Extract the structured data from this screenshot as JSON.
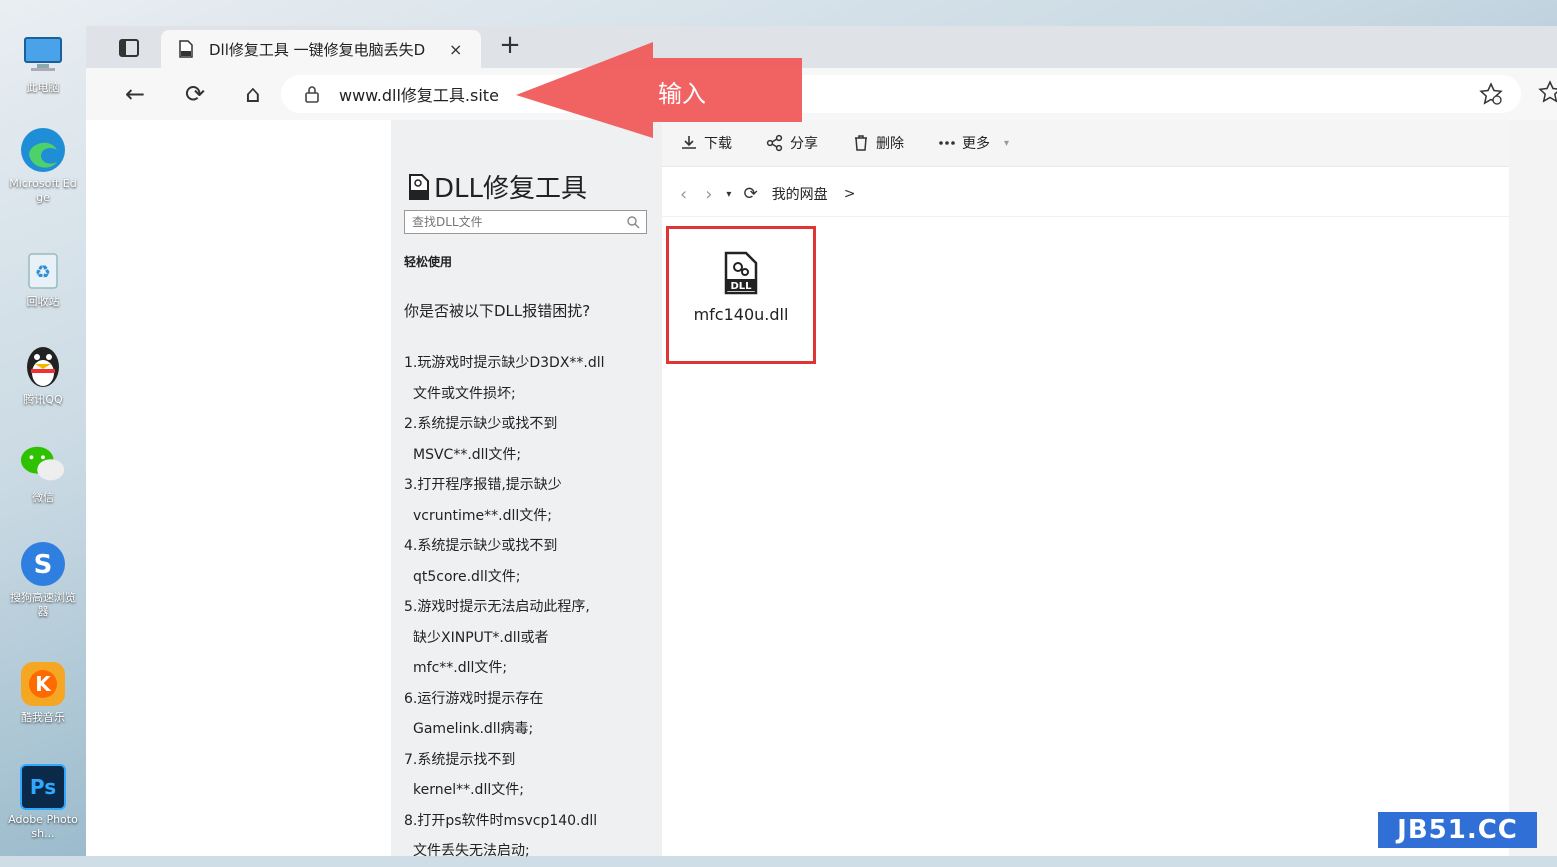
{
  "desktop": {
    "icons": [
      {
        "label": "此电脑",
        "icon": "computer-icon",
        "color": "#3a8dde"
      },
      {
        "label": "Microsoft Edge",
        "icon": "edge-icon",
        "color": "#1f8ed6"
      },
      {
        "label": "回收站",
        "icon": "recycle-bin-icon",
        "color": "#5aa9d6"
      },
      {
        "label": "腾讯QQ",
        "icon": "qq-icon",
        "color": "#222222"
      },
      {
        "label": "微信",
        "icon": "wechat-icon",
        "color": "#2dc100"
      },
      {
        "label": "搜狗高速浏览器",
        "icon": "sogou-browser-icon",
        "color": "#2f7fe0"
      },
      {
        "label": "酷我音乐",
        "icon": "kuwo-music-icon",
        "color": "#f5a623"
      },
      {
        "label": "Adobe Photosh...",
        "icon": "photoshop-icon",
        "color": "#0b2a4a"
      }
    ]
  },
  "browser": {
    "tab": {
      "title": "Dll修复工具 一键修复电脑丢失D",
      "close": "×"
    },
    "new_tab": "+",
    "nav": {
      "back": "←",
      "reload": "⟳",
      "home": "⌂"
    },
    "address": {
      "url": "www.dll修复工具.site"
    }
  },
  "annotation": {
    "label": "输入",
    "color": "#f05a5a"
  },
  "page": {
    "site_title": "DLL修复工具",
    "search": {
      "placeholder": "查找DLL文件"
    },
    "easy_use": "轻松使用",
    "question": "你是否被以下DLL报错困扰?",
    "issues": [
      {
        "line1": "1.玩游戏时提示缺少D3DX**.dll",
        "line2": "文件或文件损坏;"
      },
      {
        "line1": "2.系统提示缺少或找不到",
        "line2": "MSVC**.dll文件;"
      },
      {
        "line1": "3.打开程序报错,提示缺少",
        "line2": "vcruntime**.dll文件;"
      },
      {
        "line1": "4.系统提示缺少或找不到",
        "line2": "qt5core.dll文件;"
      },
      {
        "line1": "5.游戏时提示无法启动此程序,",
        "line2": "缺少XINPUT*.dll或者",
        "line3": "mfc**.dll文件;"
      },
      {
        "line1": "6.运行游戏时提示存在",
        "line2": "Gamelink.dll病毒;"
      },
      {
        "line1": "7.系统提示找不到",
        "line2": "kernel**.dll文件;"
      },
      {
        "line1": "8.打开ps软件时msvcp140.dll",
        "line2": "文件丢失无法启动;"
      }
    ],
    "file_toolbar": {
      "download": "下载",
      "share": "分享",
      "delete": "删除",
      "more": "更多"
    },
    "breadcrumb": {
      "home": "我的网盘",
      "sep": ">"
    },
    "file": {
      "name": "mfc140u.dll",
      "badge": "DLL"
    },
    "highlight_color": "#e03535"
  },
  "watermark": "JB51.CC"
}
